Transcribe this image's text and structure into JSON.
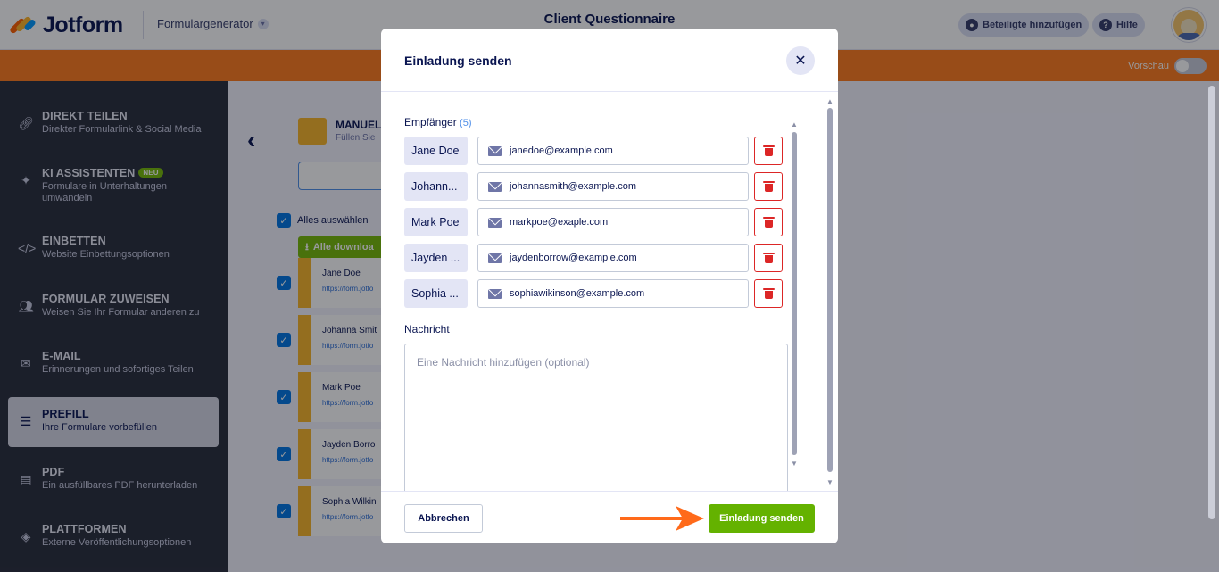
{
  "app": {
    "logo_text": "Jotform",
    "builder_label": "Formulargenerator",
    "form_title": "Client Questionnaire",
    "add_participants": "Beteiligte hinzufügen",
    "help": "Hilfe",
    "preview_label": "Vorschau"
  },
  "sidebar": {
    "items": [
      {
        "title": "DIREKT TEILEN",
        "sub": "Direkter Formularlink & Social Media",
        "icon": "link-icon"
      },
      {
        "title": "KI ASSISTENTEN",
        "badge": "NEU",
        "sub": "Formulare in Unterhaltungen umwandeln",
        "icon": "sparkle-icon"
      },
      {
        "title": "EINBETTEN",
        "sub": "Website Einbettungsoptionen",
        "icon": "code-icon"
      },
      {
        "title": "FORMULAR ZUWEISEN",
        "sub": "Weisen Sie Ihr Formular anderen zu",
        "icon": "users-icon"
      },
      {
        "title": "E-MAIL",
        "sub": "Erinnerungen und sofortiges Teilen",
        "icon": "mail-icon"
      },
      {
        "title": "PREFILL",
        "sub": "Ihre Formulare vorbefüllen",
        "icon": "database-icon",
        "active": true
      },
      {
        "title": "PDF",
        "sub": "Ein ausfüllbares PDF herunterladen",
        "icon": "pdf-icon"
      },
      {
        "title": "PLATTFORMEN",
        "sub": "Externe Veröffentlichungsoptionen",
        "icon": "layers-icon"
      }
    ]
  },
  "main": {
    "manual_title": "MANUEL",
    "manual_sub": "Füllen Sie",
    "select_all": "Alles auswählen",
    "download_all": "Alle downloa",
    "rows": [
      {
        "name": "Jane Doe",
        "url": "https://form.jotfo"
      },
      {
        "name": "Johanna Smit",
        "url": "https://form.jotfo"
      },
      {
        "name": "Mark Poe",
        "url": "https://form.jotfo"
      },
      {
        "name": "Jayden Borro",
        "url": "https://form.jotfo"
      },
      {
        "name": "Sophia Wilkin",
        "url": "https://form.jotfo"
      }
    ]
  },
  "modal": {
    "title": "Einladung senden",
    "recipients_label": "Empfänger",
    "recipients_count": "(5)",
    "recipients": [
      {
        "name": "Jane Doe",
        "email": "janedoe@example.com"
      },
      {
        "name": "Johann...",
        "email": "johannasmith@example.com"
      },
      {
        "name": "Mark Poe",
        "email": "markpoe@exaple.com"
      },
      {
        "name": "Jayden ...",
        "email": "jaydenborrow@example.com"
      },
      {
        "name": "Sophia ...",
        "email": "sophiawikinson@example.com"
      }
    ],
    "message_label": "Nachricht",
    "message_placeholder": "Eine Nachricht hinzufügen (optional)",
    "cancel": "Abbrechen",
    "send": "Einladung senden"
  },
  "colors": {
    "accent_orange": "#ff7b1c",
    "send_green": "#64b200",
    "delete_red": "#dc2626",
    "sidebar_bg": "#292d3c"
  }
}
